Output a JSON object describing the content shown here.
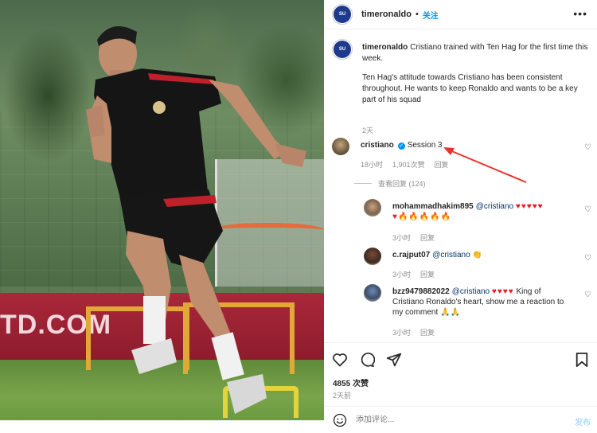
{
  "photo": {
    "board_text": "TD.COM"
  },
  "header": {
    "avatar_text": "SU",
    "username": "timeronaldo",
    "dot": "•",
    "follow_label": "关注",
    "more_icon": "more-dots-icon"
  },
  "caption": {
    "username": "timeronaldo",
    "text1": "Cristiano trained with Ten Hag for the first time this week.",
    "text2": "Ten Hag's attitude towards Cristiano has been consistent throughout. He wants to keep Ronaldo and wants to be a key part of his squad",
    "time": "2天"
  },
  "comments": [
    {
      "username": "cristiano",
      "verified": true,
      "text": "Session 3",
      "time": "18小时",
      "likes": "1,901次赞",
      "reply": "回复",
      "view_replies": "查看回复 (124)"
    },
    {
      "username": "mohammadhakim895",
      "mention": "@cristiano",
      "hearts": "♥♥♥♥♥",
      "line2_hearts": "♥",
      "fires": "🔥🔥🔥🔥🔥",
      "time": "3小时",
      "reply": "回复"
    },
    {
      "username": "c.rajput07",
      "mention": "@cristiano",
      "emoji": "👏",
      "time": "3小时",
      "reply": "回复"
    },
    {
      "username": "bzz9479882022",
      "mention": "@cristiano",
      "hearts": "♥♥♥♥",
      "text_after": "King of",
      "line2": "Cristiano Ronaldo's heart, show me a reaction to",
      "line3": "my comment",
      "emoji": "🙏🙏",
      "time": "3小时",
      "reply": "回复"
    }
  ],
  "actions": {
    "likes": "4855 次赞",
    "time": "2天前"
  },
  "add_comment": {
    "placeholder": "添加评论...",
    "post_label": "发布"
  },
  "colors": {
    "accent": "#0095f6",
    "annotation_arrow": "#e8322e"
  }
}
